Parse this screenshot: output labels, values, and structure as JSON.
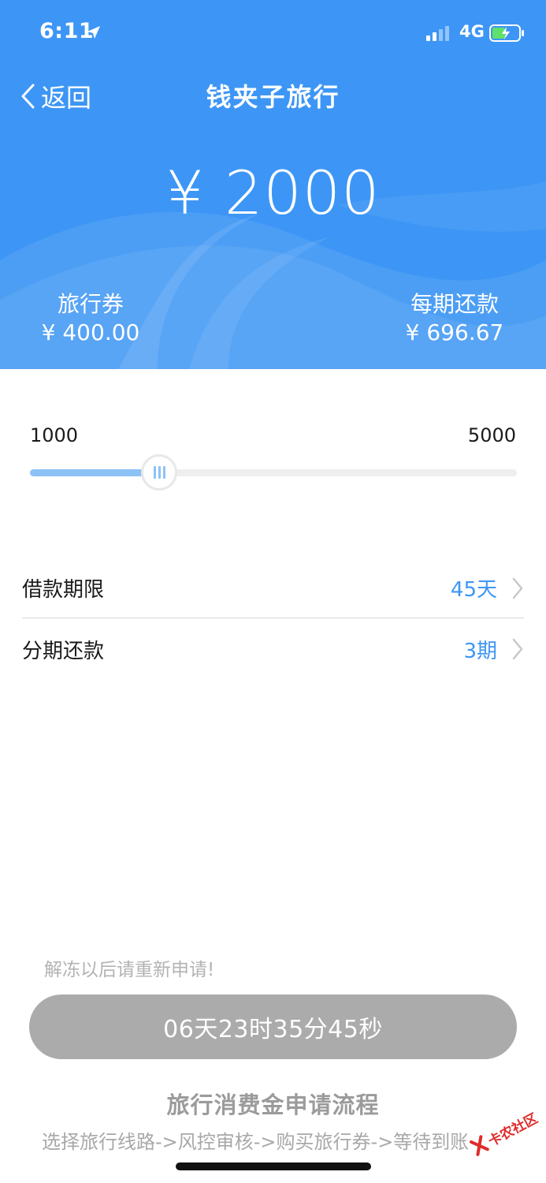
{
  "status_bar": {
    "time": "6:11",
    "network": "4G"
  },
  "nav": {
    "back_label": "返回",
    "title": "钱夹子旅行"
  },
  "loan": {
    "amount": "¥ 2000",
    "voucher_label": "旅行券",
    "voucher_value": "¥ 400.00",
    "installment_label": "每期还款",
    "installment_value": "¥ 696.67"
  },
  "slider": {
    "min_label": "1000",
    "max_label": "5000",
    "min": 1000,
    "max": 5000,
    "value": 2000
  },
  "options": [
    {
      "label": "借款期限",
      "value": "45天"
    },
    {
      "label": "分期还款",
      "value": "3期"
    }
  ],
  "notice": "解冻以后请重新申请!",
  "countdown_label": "06天23时35分45秒",
  "process": {
    "title": "旅行消费金申请流程",
    "steps": "选择旅行线路->风控审核->购买旅行券->等待到账"
  },
  "watermark": {
    "text": "卡农社区"
  },
  "colors": {
    "primary": "#3d96f5",
    "slider_fill": "#8dc2f7",
    "disabled_button": "#ababab"
  }
}
